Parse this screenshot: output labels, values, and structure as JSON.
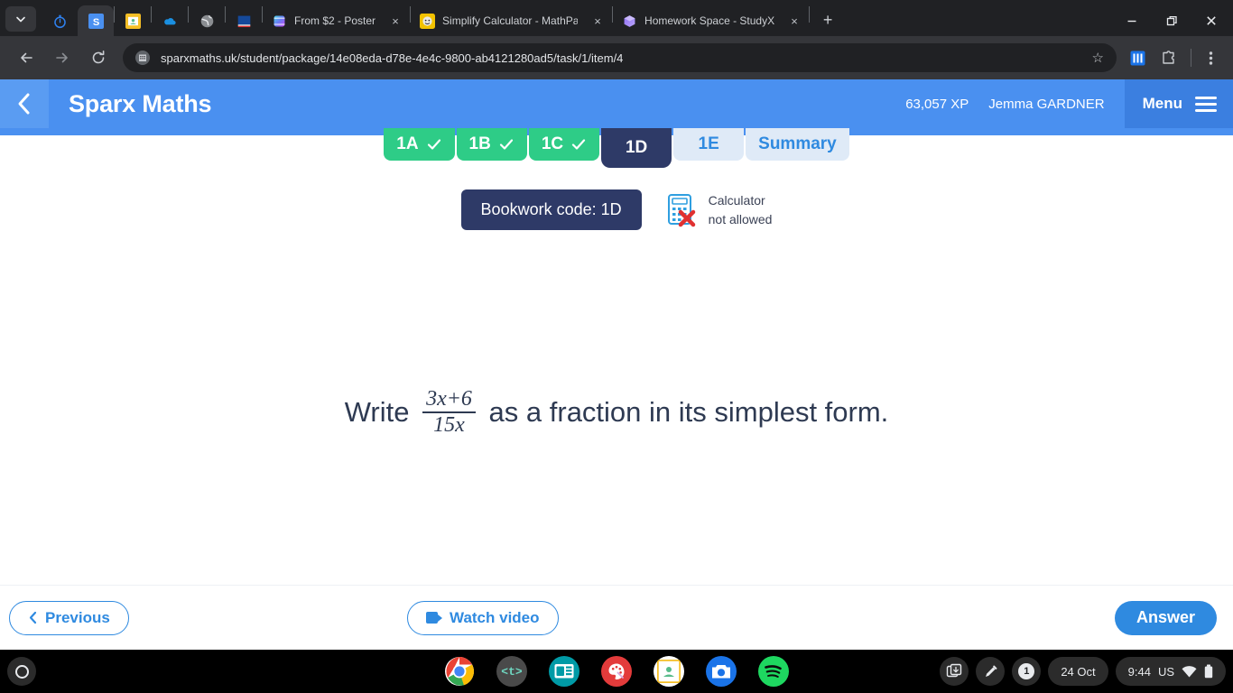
{
  "browser": {
    "pinned_tabs": [
      {
        "name": "timer-tab",
        "icon": "stopwatch-icon"
      },
      {
        "name": "sparx-tab",
        "icon": "sparx-s-icon",
        "active": true
      },
      {
        "name": "classroom-tab",
        "icon": "google-classroom-icon"
      },
      {
        "name": "onedrive-tab",
        "icon": "onedrive-cloud-icon"
      },
      {
        "name": "globe-tab",
        "icon": "globe-icon"
      },
      {
        "name": "book-tab",
        "icon": "book-icon"
      }
    ],
    "tabs": [
      {
        "title": "From $2 - Poster",
        "icon": "gradient-cube-icon"
      },
      {
        "title": "Simplify Calculator - MathPapa",
        "icon": "mathpapa-face-icon"
      },
      {
        "title": "Homework Space - StudyX",
        "icon": "studyx-cube-icon"
      }
    ],
    "new_tab_label": "+",
    "close_label": "×",
    "window_controls": {
      "minimize": "—",
      "maximize": "❐",
      "close": "✕"
    },
    "url": "sparxmaths.uk/student/package/14e08eda-d78e-4e4c-9800-ab4121280ad5/task/1/item/4",
    "star_label": "☆"
  },
  "app_header": {
    "title": "Sparx Maths",
    "xp": "63,057 XP",
    "user": "Jemma GARDNER",
    "menu_label": "Menu",
    "accent": "#4a90f0",
    "menu_bg": "#3b7fe0"
  },
  "task_tabs": [
    {
      "label": "1A",
      "state": "done"
    },
    {
      "label": "1B",
      "state": "done"
    },
    {
      "label": "1C",
      "state": "done"
    },
    {
      "label": "1D",
      "state": "current"
    },
    {
      "label": "1E",
      "state": "todo"
    },
    {
      "label": "Summary",
      "state": "todo"
    }
  ],
  "bookwork": {
    "code_label": "Bookwork code: 1D",
    "calculator_line1": "Calculator",
    "calculator_line2": "not allowed"
  },
  "question": {
    "prefix": "Write ",
    "fraction_numerator": "3x+6",
    "fraction_denominator": "15x",
    "suffix": " as a fraction in its simplest form."
  },
  "footer": {
    "previous_label": "Previous",
    "watch_video_label": "Watch video",
    "answer_label": "Answer"
  },
  "shelf": {
    "apps": [
      {
        "name": "chrome-app-icon",
        "running": true
      },
      {
        "name": "ttrockstars-app-icon",
        "label": "<t>",
        "running": false
      },
      {
        "name": "news-app-icon",
        "running": false
      },
      {
        "name": "paint-app-icon",
        "running": false
      },
      {
        "name": "google-classroom-app-icon",
        "running": true
      },
      {
        "name": "camera-app-icon",
        "running": false
      },
      {
        "name": "spotify-app-icon",
        "running": false
      }
    ],
    "tray": {
      "notification_count": "1",
      "date": "24 Oct",
      "time": "9:44",
      "locale": "US"
    }
  }
}
